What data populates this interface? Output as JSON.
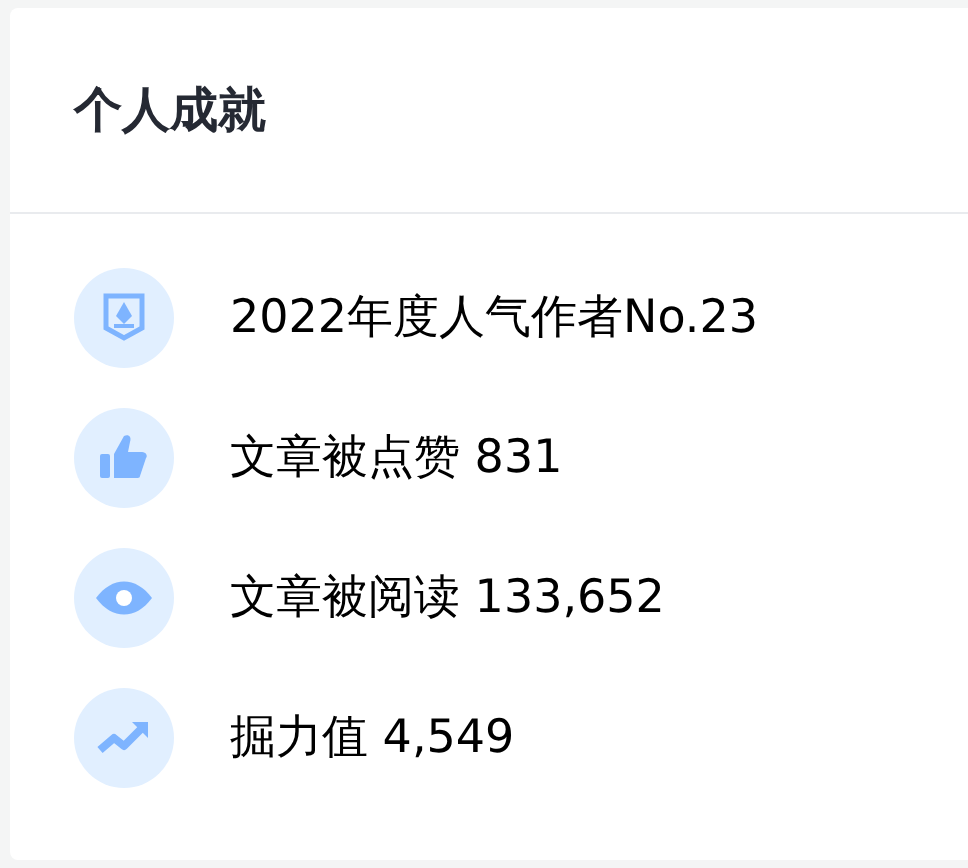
{
  "title": "个人成就",
  "items": [
    {
      "kind": "badge",
      "text": "2022年度人气作者No.23"
    },
    {
      "kind": "like",
      "text": "文章被点赞 831"
    },
    {
      "kind": "view",
      "text": "文章被阅读 133,652"
    },
    {
      "kind": "power",
      "text": "掘力值 4,549"
    }
  ]
}
